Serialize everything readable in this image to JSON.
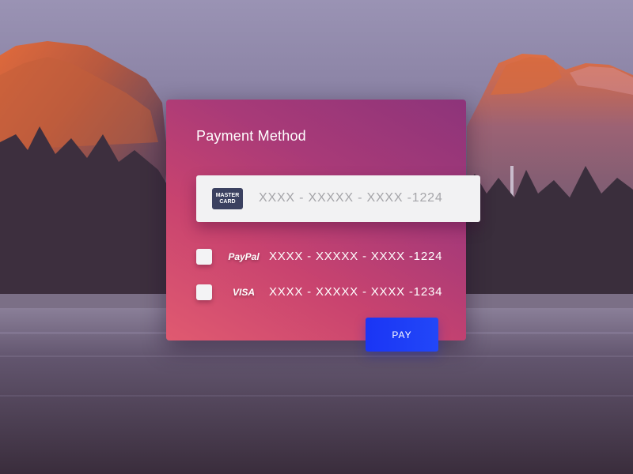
{
  "background": {
    "scene": "mountain-valley-lake"
  },
  "colors": {
    "card_gradient_start": "#e05a70",
    "card_gradient_end": "#8d347a",
    "pay_button": "#1e3ef7",
    "card_badge": "#3b4160"
  },
  "payment": {
    "title": "Payment Method",
    "selected": {
      "badge_line1": "MASTER",
      "badge_line2": "CARD",
      "badge_icon": "mastercard-icon",
      "number": "XXXX - XXXXX - XXXX -1224"
    },
    "options": [
      {
        "brand": "PayPal",
        "brand_icon": "paypal-icon",
        "number": "XXXX - XXXXX - XXXX -1224",
        "checked": false
      },
      {
        "brand": "VISA",
        "brand_icon": "visa-icon",
        "number": "XXXX - XXXXX - XXXX -1234",
        "checked": false
      }
    ],
    "pay_label": "PAY"
  }
}
